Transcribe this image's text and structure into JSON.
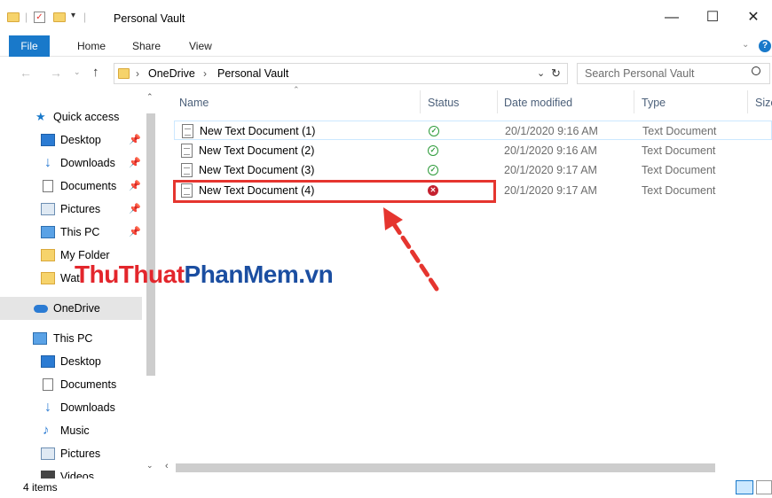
{
  "window": {
    "title": "Personal Vault",
    "controls": {
      "minimize": "—",
      "maximize": "☐",
      "close": "✕"
    }
  },
  "ribbon": {
    "tabs": [
      "File",
      "Home",
      "Share",
      "View"
    ],
    "expand_icon": "chevron-down-icon",
    "help": "?"
  },
  "navigation": {
    "breadcrumb": [
      "OneDrive",
      "Personal Vault"
    ],
    "search_placeholder": "Search Personal Vault"
  },
  "sidebar": {
    "quick_access_label": "Quick access",
    "quick_access_items": [
      {
        "label": "Desktop",
        "icon": "desktop-icon",
        "pinned": true
      },
      {
        "label": "Downloads",
        "icon": "downloads-icon",
        "pinned": true
      },
      {
        "label": "Documents",
        "icon": "documents-icon",
        "pinned": true
      },
      {
        "label": "Pictures",
        "icon": "pictures-icon",
        "pinned": true
      },
      {
        "label": "This PC",
        "icon": "computer-icon",
        "pinned": true
      },
      {
        "label": "My Folder",
        "icon": "folder-icon",
        "pinned": false
      },
      {
        "label": "Wat",
        "icon": "folder-icon",
        "pinned": false
      }
    ],
    "onedrive_label": "OneDrive",
    "this_pc_label": "This PC",
    "this_pc_items": [
      {
        "label": "Desktop",
        "icon": "desktop-icon"
      },
      {
        "label": "Documents",
        "icon": "documents-icon"
      },
      {
        "label": "Downloads",
        "icon": "downloads-icon"
      },
      {
        "label": "Music",
        "icon": "music-icon"
      },
      {
        "label": "Pictures",
        "icon": "pictures-icon"
      },
      {
        "label": "Videos",
        "icon": "videos-icon"
      }
    ]
  },
  "columns": [
    "Name",
    "Status",
    "Date modified",
    "Type",
    "Size"
  ],
  "files": [
    {
      "name": "New Text Document (1)",
      "status": "synced",
      "date": "20/1/2020 9:16 AM",
      "type": "Text Document"
    },
    {
      "name": "New Text Document (2)",
      "status": "synced",
      "date": "20/1/2020 9:16 AM",
      "type": "Text Document"
    },
    {
      "name": "New Text Document (3)",
      "status": "synced",
      "date": "20/1/2020 9:17 AM",
      "type": "Text Document"
    },
    {
      "name": "New Text Document (4)",
      "status": "error",
      "date": "20/1/2020 9:17 AM",
      "type": "Text Document"
    }
  ],
  "status_bar": {
    "item_count": "4 items"
  },
  "watermark": {
    "part1": "ThuThuat",
    "part2": "PhanMem",
    "part3": ".vn"
  },
  "colors": {
    "accent": "#1979ca",
    "highlight": "#e5352f",
    "ok": "#2e9b3b",
    "error": "#c4202f"
  }
}
